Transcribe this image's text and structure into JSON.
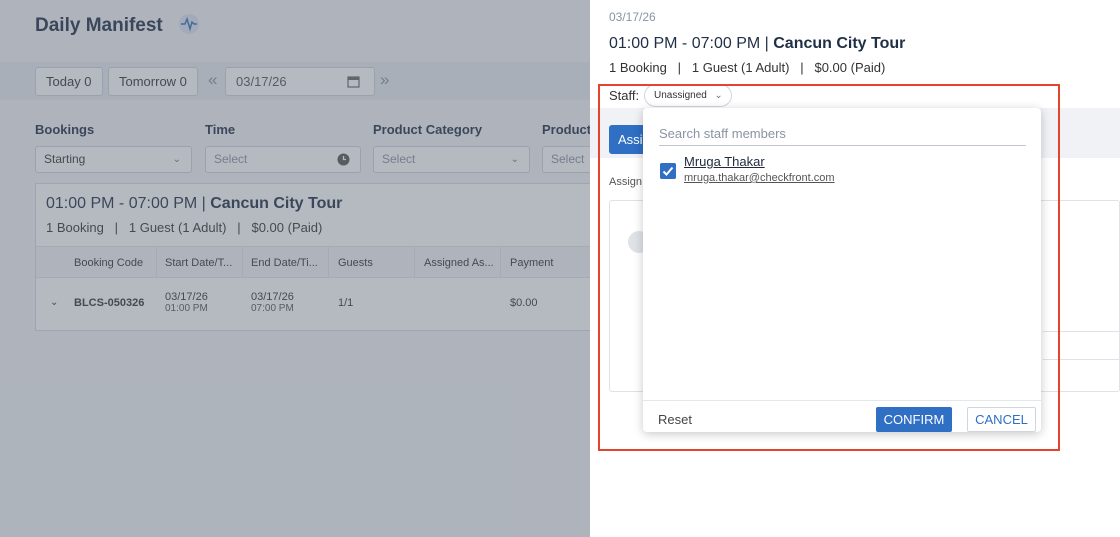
{
  "page": {
    "title": "Daily Manifest"
  },
  "toolbar": {
    "today": "Today 0",
    "tomorrow": "Tomorrow 0",
    "prev": "«",
    "next": "»",
    "date": "03/17/26"
  },
  "filters": {
    "bookings": {
      "label": "Bookings",
      "value": "Starting"
    },
    "time": {
      "label": "Time",
      "placeholder": "Select"
    },
    "product_category": {
      "label": "Product Category",
      "placeholder": "Select"
    },
    "product": {
      "label": "Product",
      "placeholder": "Select"
    }
  },
  "card": {
    "time": "01:00 PM - 07:00 PM | ",
    "tour": "Cancun City Tour",
    "summary": "1 Booking   |   1 Guest (1 Adult)   |   $0.00 (Paid)",
    "columns": [
      "Booking Code",
      "Start Date/T...",
      "End Date/Ti...",
      "Guests",
      "Assigned As...",
      "Payment"
    ],
    "row": {
      "code": "BLCS-050326",
      "start_date": "03/17/26",
      "start_time": "01:00 PM",
      "end_date": "03/17/26",
      "end_time": "07:00 PM",
      "guests": "1/1",
      "payment": "$0.00"
    }
  },
  "drawer": {
    "date": "03/17/26",
    "time": "01:00 PM - 07:00 PM | ",
    "tour": "Cancun City Tour",
    "summary": "1 Booking   |   1 Guest (1 Adult)   |   $0.00 (Paid)",
    "staff_label": "Staff:",
    "staff_value": "Unassigned",
    "assign_button": "Assi",
    "assign_text": "Assign"
  },
  "dropdown": {
    "search_placeholder": "Search staff members",
    "options": [
      {
        "name": "Mruga Thakar",
        "email": "mruga.thakar@checkfront.com",
        "checked": true
      }
    ],
    "reset": "Reset",
    "confirm": "CONFIRM",
    "cancel": "CANCEL"
  },
  "colors": {
    "accent": "#2f6fc4",
    "highlight": "#e4432d"
  }
}
